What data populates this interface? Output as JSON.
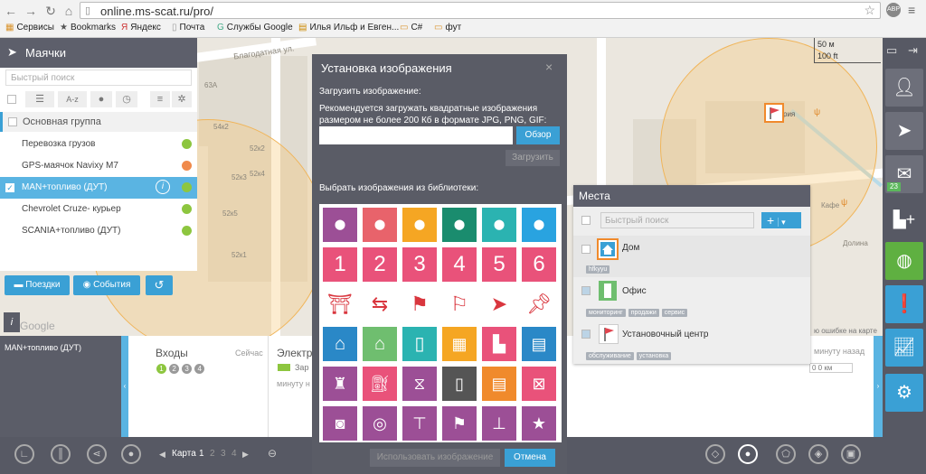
{
  "browser": {
    "url": "online.ms-scat.ru/pro/",
    "bookmarks": [
      "Сервисы",
      "Bookmarks",
      "Яндекс",
      "Почта",
      "Службы Google",
      "Илья Ильф и Евген...",
      "C#",
      "фут"
    ]
  },
  "map": {
    "street": "Благодатная ул.",
    "labels": [
      "63А",
      "52к2",
      "52к4",
      "52к3",
      "52к1",
      "52к5",
      "54к2",
      "Кафе",
      "рия",
      "Долина"
    ],
    "scale": {
      "m": "50 м",
      "ft": "100 ft"
    },
    "hint_right_1": "ю ошибке на карте",
    "hint_right_2": "минуту назад",
    "speed_unit": "км"
  },
  "left_panel": {
    "title": "Маячки",
    "search_placeholder": "Быстрый поиск",
    "sort_az": "A-z",
    "group": "Основная группа",
    "items": [
      {
        "label": "Перевозка грузов",
        "color": "#8dc63f"
      },
      {
        "label": "GPS-маячок Navixy M7",
        "color": "#f08a4b"
      },
      {
        "label": "MAN+топливо (ДУТ)",
        "color": "#8dc63f"
      },
      {
        "label": "Chevrolet Cruze- курьер",
        "color": "#8dc63f"
      },
      {
        "label": "SCANIA+топливо (ДУТ)",
        "color": "#8dc63f"
      }
    ],
    "btn_trips": "Поездки",
    "btn_events": "События",
    "google": "Google"
  },
  "bottom": {
    "vehicle": "MAN+топливо (ДУТ)",
    "inputs_label": "Входы",
    "inputs_time": "Сейчас",
    "inputs": [
      "1",
      "2",
      "3",
      "4"
    ],
    "electro_label": "Электро",
    "electro_status": "Зар",
    "electro_time": "минуту н",
    "map_label": "Карта",
    "map_pages": [
      "1",
      "2",
      "3",
      "4"
    ]
  },
  "dialog": {
    "title": "Установка изображения",
    "upload_label": "Загрузить изображение:",
    "recommend": "Рекомендуется загружать квадратные изображения размером не более 200 Кб в формате JPG, PNG, GIF:",
    "browse": "Обзор",
    "upload": "Загрузить",
    "library_label": "Выбрать изображения из библиотеки:",
    "numbers": [
      "1",
      "2",
      "3",
      "4",
      "5",
      "6"
    ],
    "use_image": "Использовать изображение",
    "cancel": "Отмена"
  },
  "places": {
    "title": "Места",
    "search_placeholder": "Быстрый поиск",
    "items": [
      {
        "name": "Дом",
        "tags": [
          "hfkyyu"
        ]
      },
      {
        "name": "Офис",
        "tags": [
          "мониторинг",
          "продажи",
          "сервис"
        ]
      },
      {
        "name": "Установочный центр",
        "tags": [
          "обслуживание",
          "установка"
        ]
      }
    ]
  },
  "right_toolbar": {
    "badge": "23"
  }
}
